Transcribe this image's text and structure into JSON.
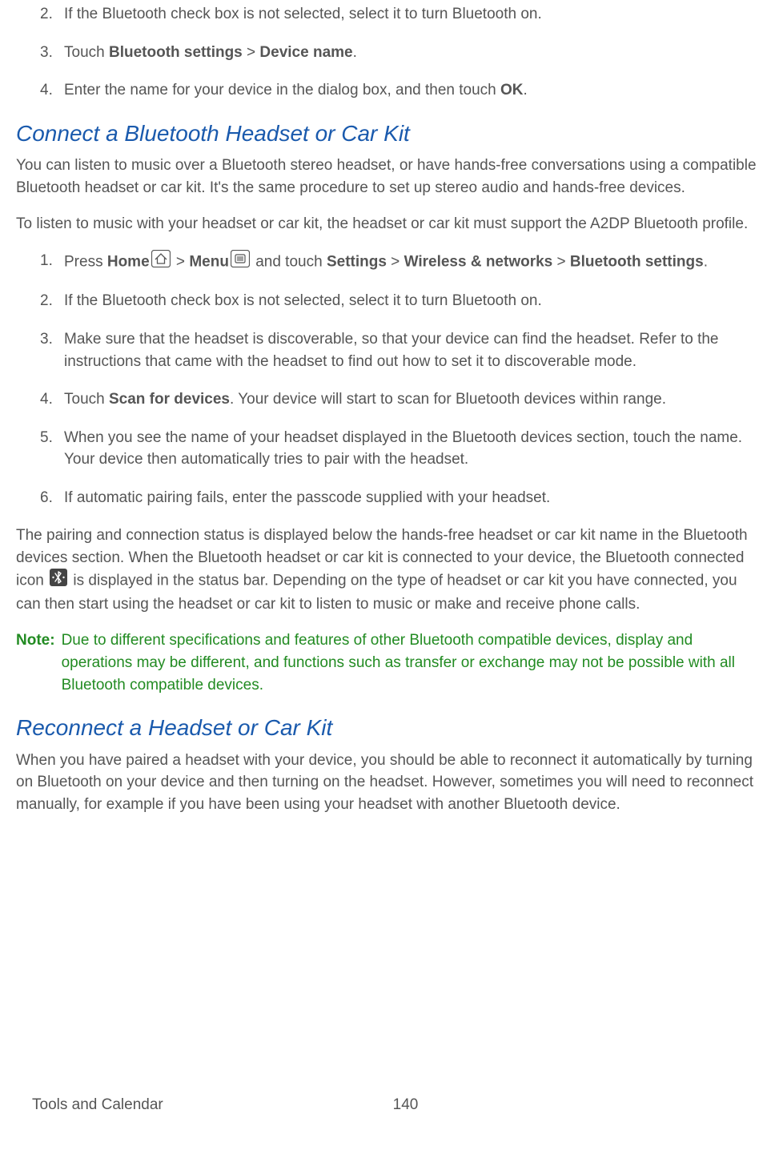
{
  "listA": {
    "items": [
      {
        "num": "2.",
        "parts": [
          {
            "text": "If the Bluetooth check box is not selected, select it to turn Bluetooth on."
          }
        ]
      },
      {
        "num": "3.",
        "parts": [
          {
            "text": "Touch "
          },
          {
            "bold": true,
            "text": "Bluetooth settings"
          },
          {
            "text": " > "
          },
          {
            "bold": true,
            "text": "Device name"
          },
          {
            "text": "."
          }
        ]
      },
      {
        "num": "4.",
        "parts": [
          {
            "text": "Enter the name for your device in the dialog box, and then touch "
          },
          {
            "bold": true,
            "text": "OK"
          },
          {
            "text": "."
          }
        ]
      }
    ]
  },
  "heading1": "Connect a Bluetooth Headset or Car Kit",
  "paraA": "You can listen to music over a Bluetooth stereo headset, or have hands-free conversations using a compatible Bluetooth headset or car kit. It's the same procedure to set up stereo audio and hands-free devices.",
  "paraB": "To listen to music with your headset or car kit, the headset or car kit must support the A2DP Bluetooth profile.",
  "listB": {
    "item1": {
      "num": "1.",
      "t1": "Press ",
      "t2": "Home",
      "t3": " > ",
      "t4": "Menu",
      "t5": " and touch ",
      "t6": "Settings",
      "t7": " > ",
      "t8": "Wireless & networks",
      "t9": " > ",
      "t10": "Bluetooth settings",
      "t11": "."
    },
    "item2": {
      "num": "2.",
      "text": "If the Bluetooth check box is not selected, select it to turn Bluetooth on."
    },
    "item3": {
      "num": "3.",
      "text": "Make sure that the headset is discoverable, so that your device can find the headset. Refer to the instructions that came with the headset to find out how to set it to discoverable mode."
    },
    "item4": {
      "num": "4.",
      "t1": "Touch ",
      "t2": "Scan for devices",
      "t3": ". Your device will start to scan for Bluetooth devices within range."
    },
    "item5": {
      "num": "5.",
      "text": "When you see the name of your headset displayed in the Bluetooth devices section, touch the name. Your device then automatically tries to pair with the headset."
    },
    "item6": {
      "num": "6.",
      "text": "If automatic pairing fails, enter the passcode supplied with your headset."
    }
  },
  "paraC": {
    "t1": "The pairing and connection status is displayed below the hands-free headset or car kit name in the Bluetooth devices section. When the Bluetooth headset or car kit is connected to your device, the Bluetooth connected icon ",
    "t2": " is displayed in the status bar. Depending on the type of headset or car kit you have connected, you can then start using the headset or car kit to listen to music or make and receive phone calls."
  },
  "note": {
    "label": "Note:",
    "text": "Due to different specifications and features of other Bluetooth compatible devices, display and operations may be different, and functions such as transfer or exchange may not be possible with all Bluetooth compatible devices."
  },
  "heading2": "Reconnect a Headset or Car Kit",
  "paraD": "When you have paired a headset with your device, you should be able to reconnect it automatically by turning on Bluetooth on your device and then turning on the headset. However, sometimes you will need to reconnect manually, for example if you have been using your headset with another Bluetooth device.",
  "footer": {
    "section": "Tools and Calendar",
    "page": "140"
  }
}
